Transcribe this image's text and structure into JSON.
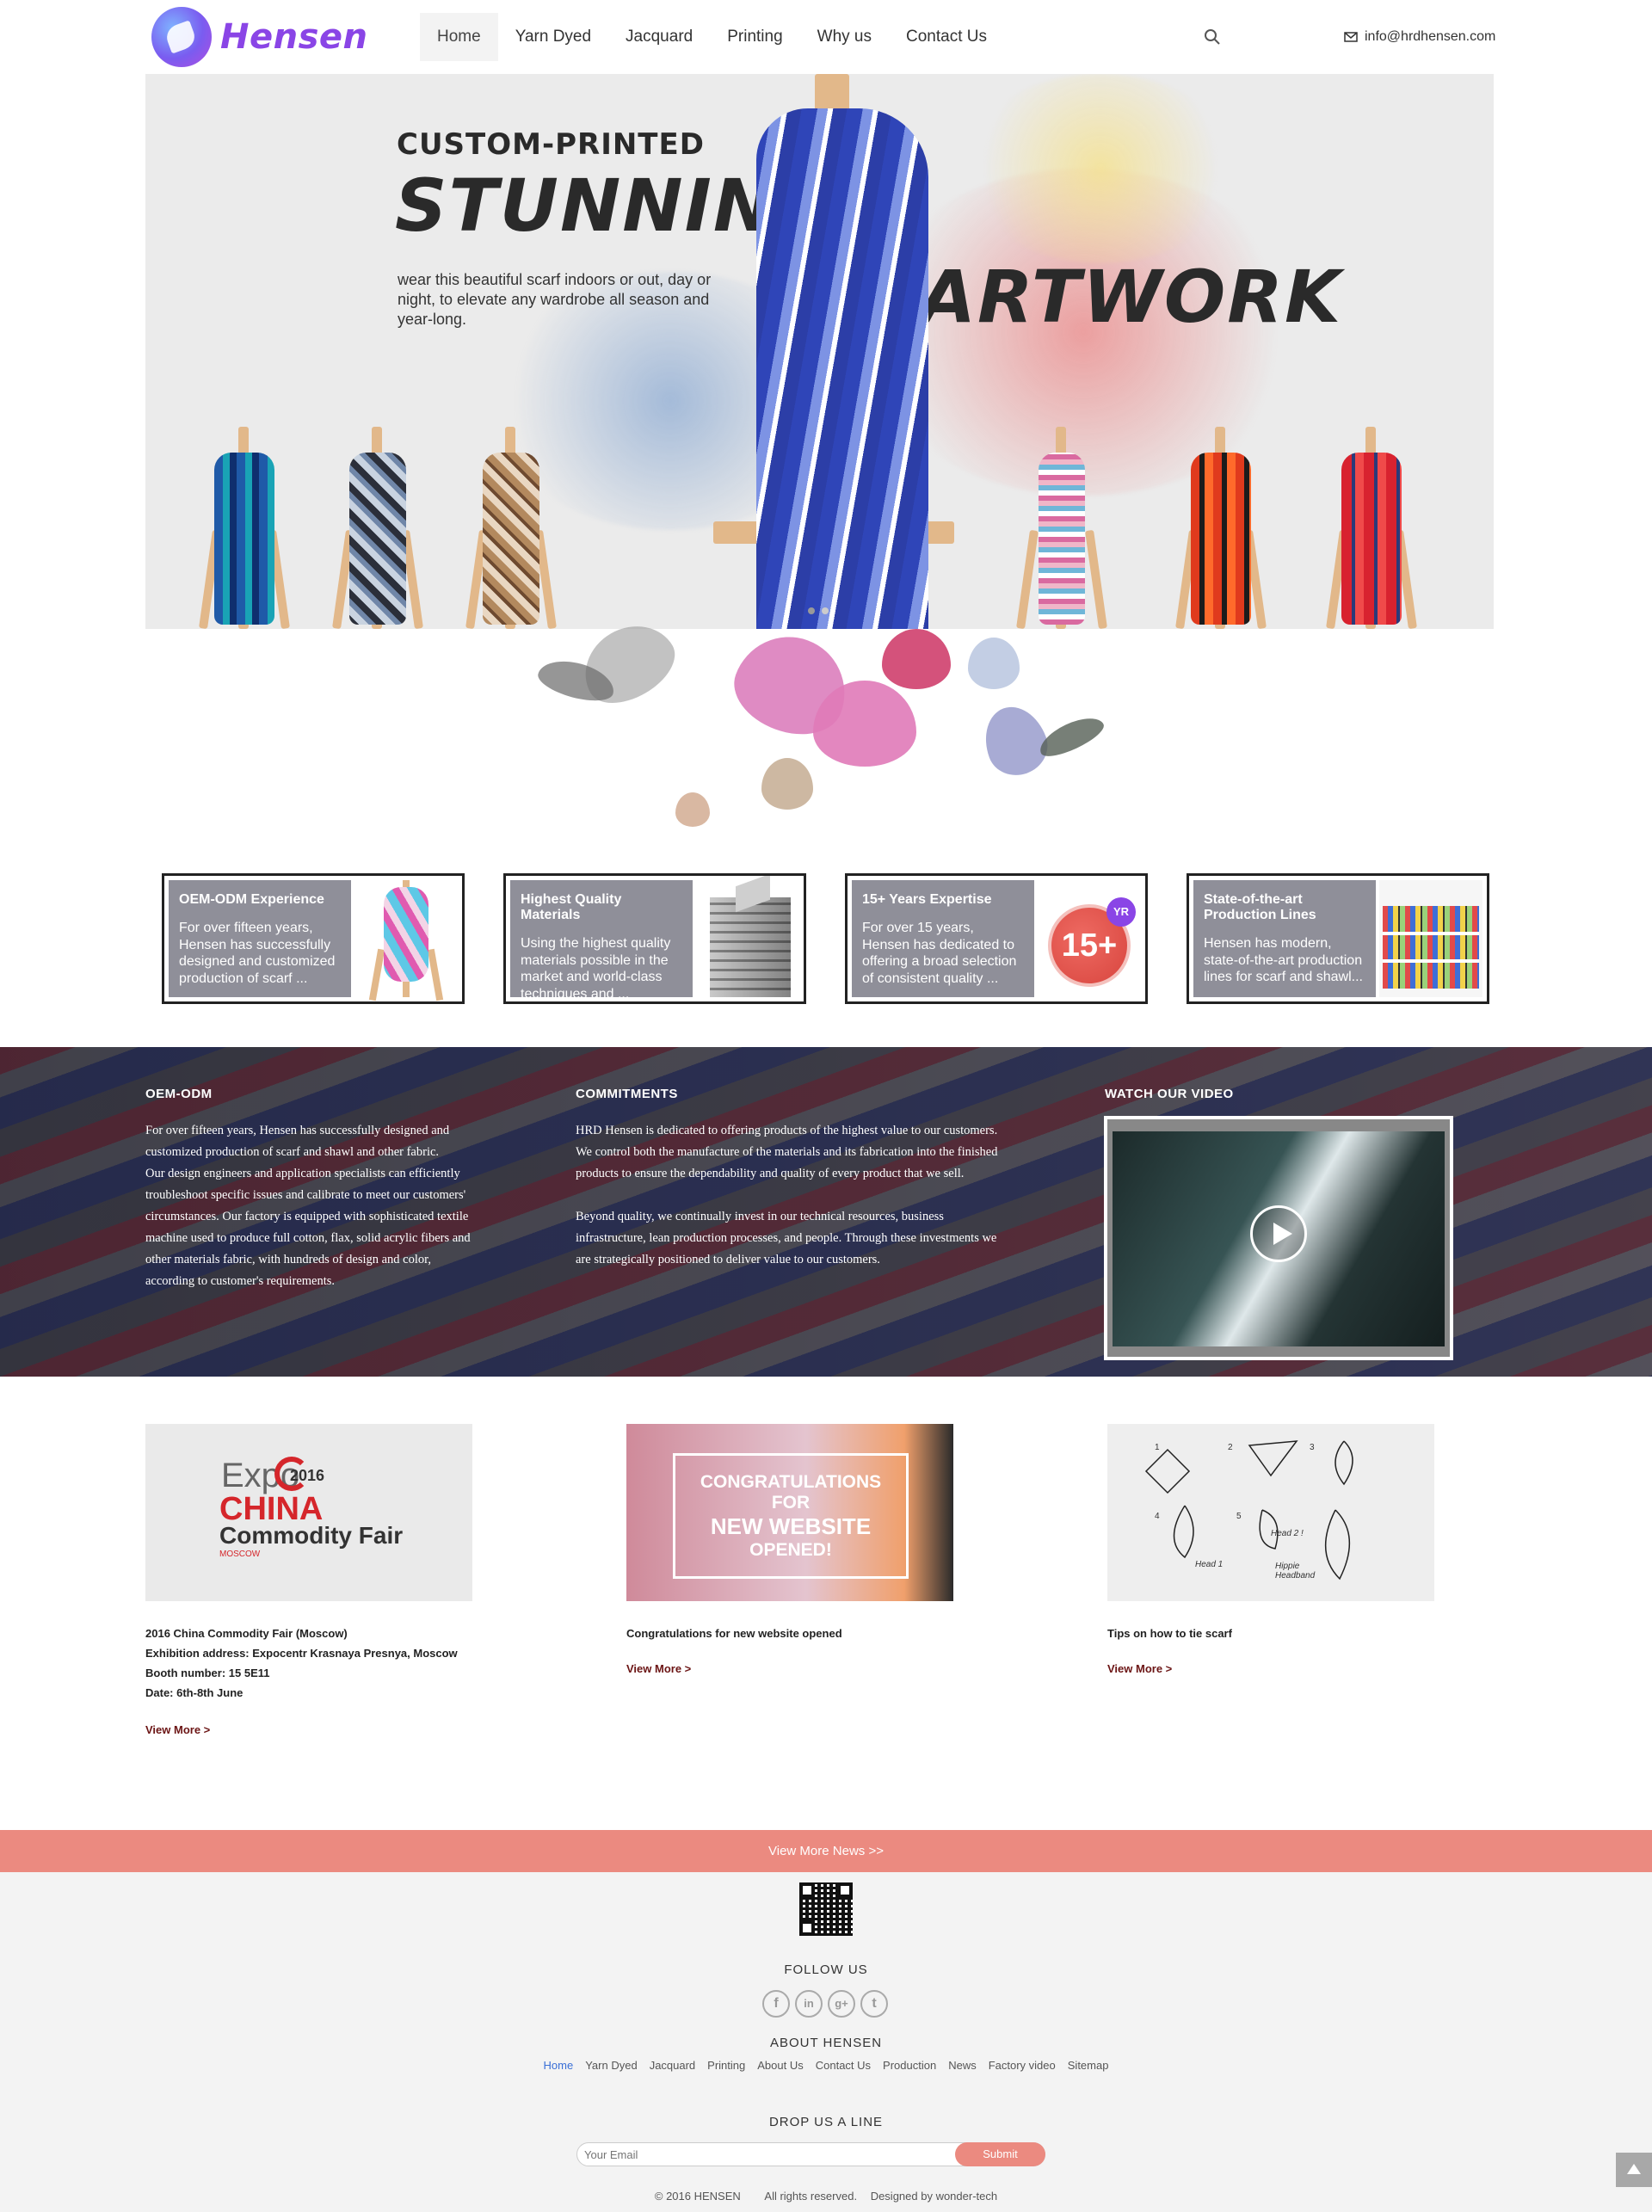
{
  "header": {
    "logo_text": "Hensen",
    "nav": [
      "Home",
      "Yarn Dyed",
      "Jacquard",
      "Printing",
      "Why us",
      "Contact Us"
    ],
    "active_nav": "Home",
    "email": "info@hrdhensen.com"
  },
  "hero": {
    "small_title": "CUSTOM-PRINTED",
    "big_title": "STUNNING",
    "art_title": "ARTWORK",
    "description": "wear this beautiful scarf indoors or out, day or night, to elevate any wardrobe all season and year-long."
  },
  "features": [
    {
      "title": "OEM-ODM Experience",
      "text": "For over fifteen years, Hensen has successfully designed and customized production of scarf ..."
    },
    {
      "title": "Highest Quality Materials",
      "text": "Using the highest quality materials possible in the market and world-class techniques and ..."
    },
    {
      "title": "15+ Years Expertise",
      "text": "For over 15 years, Hensen has dedicated to offering a broad selection of consistent quality ..."
    },
    {
      "title": "State-of-the-art Production Lines",
      "text": "Hensen has modern, state-of-the-art production lines for scarf and shawl..."
    }
  ],
  "badge": {
    "number": "15+",
    "suffix": "YR"
  },
  "info": {
    "oem_title": "OEM-ODM",
    "oem_p1": "For over fifteen years, Hensen has successfully designed and customized production of scarf and shawl and other fabric.",
    "oem_p2": "Our design engineers and application specialists can efficiently troubleshoot specific issues and calibrate to meet our customers' circumstances.  Our factory is equipped with sophisticated textile machine used to produce full cotton, flax, solid acrylic fibers and other materials fabric, with hundreds of design and color, according to customer's requirements.",
    "commit_title": "COMMITMENTS",
    "commit_p1": "HRD Hensen is dedicated to offering products of the highest value to our customers.  We control both the manufacture of the materials and its fabrication into the finished products to ensure the dependability and quality of every product that we sell.",
    "commit_p2": "Beyond quality, we continually invest in our technical resources, business infrastructure, lean production processes, and people.  Through these investments we are strategically positioned to deliver value to our customers.",
    "video_title": "WATCH OUR VIDEO"
  },
  "news": [
    {
      "img_expo": "Expo",
      "img_year": "2016",
      "img_china": "CHINA",
      "img_fair": "Commodity Fair",
      "img_city": "MOSCOW",
      "lines": [
        "2016 China Commodity Fair (Moscow)",
        "Exhibition address: Expocentr Krasnaya Presnya, Moscow",
        "Booth number: 15 5E11",
        "Date: 6th-8th June"
      ],
      "more": "View More >"
    },
    {
      "img_text": "CONGRATULATIONS FOR NEW WEBSITE OPENED!",
      "img_lines": [
        "CONGRATULATIONS",
        "FOR",
        "NEW WEBSITE",
        "OPENED!"
      ],
      "lines": [
        "Congratulations for new website opened"
      ],
      "more": "View More >"
    },
    {
      "img_labels": [
        "1",
        "2",
        "3",
        "4",
        "5",
        "Head 1",
        "Head 2 !",
        "Hippie Headband"
      ],
      "lines": [
        "Tips on how to tie scarf"
      ],
      "more": "View More >"
    }
  ],
  "view_more_news": "View More News  >>",
  "footer": {
    "follow_title": "FOLLOW US",
    "social": [
      "f",
      "in",
      "g+",
      "t"
    ],
    "about_title": "ABOUT HENSEN",
    "links": [
      "Home",
      "Yarn Dyed",
      "Jacquard",
      "Printing",
      "About Us",
      "Contact Us",
      "Production",
      "News",
      "Factory video",
      "Sitemap"
    ],
    "drop_title": "DROP US A LINE",
    "email_placeholder": "Your Email",
    "submit": "Submit",
    "copyright": "© 2016 HENSEN",
    "rights": "All rights reserved.",
    "designed": "Designed by wonder-tech"
  },
  "colors": {
    "accent": "#eb8a80",
    "brand": "#8a45e6",
    "link_active": "#3a6fd6"
  }
}
